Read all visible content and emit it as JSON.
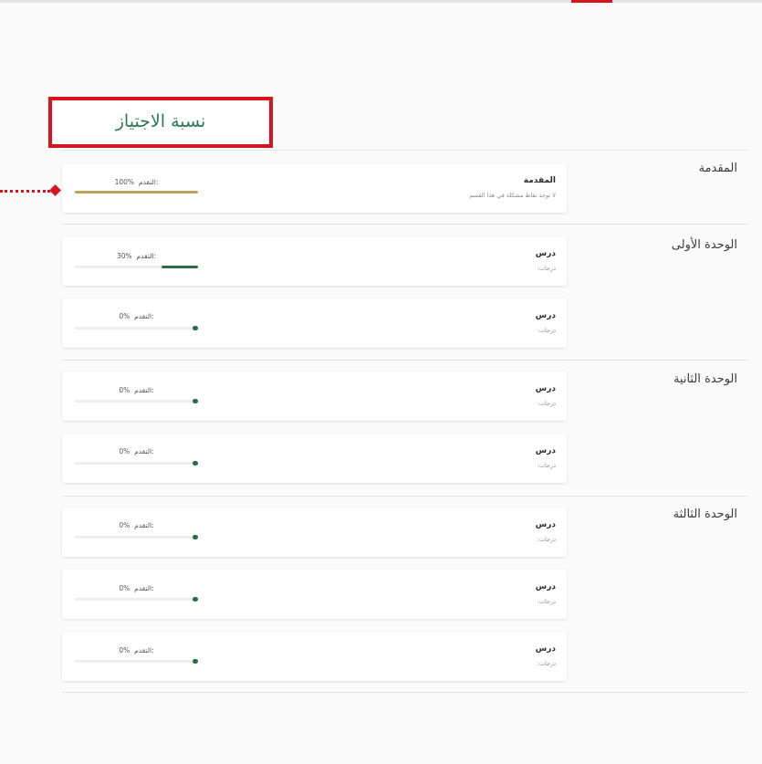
{
  "callout": {
    "text": "نسبة الاجتياز"
  },
  "progress_prefix": "التقدم:",
  "colors": {
    "accent_red": "#d5141d",
    "done_gold": "#c1a05b",
    "progress_green": "#2e6b45",
    "callout_text": "#2c7c50"
  },
  "sections": [
    {
      "title": "المقدمة",
      "cards": [
        {
          "title": "المقدمة",
          "subtitle": "لا توجد نقاط مشكلة في هذا القسم",
          "percent": "100%",
          "progress": 1.0
        }
      ]
    },
    {
      "title": "الوحدة الأولى",
      "cards": [
        {
          "title": "درس",
          "subtitle": "درجات:",
          "percent": "30%",
          "progress": 0.3
        },
        {
          "title": "درس",
          "subtitle": "درجات:",
          "percent": "0%",
          "progress": 0
        }
      ]
    },
    {
      "title": "الوحدة الثانية",
      "cards": [
        {
          "title": "درس",
          "subtitle": "درجات:",
          "percent": "0%",
          "progress": 0
        },
        {
          "title": "درس",
          "subtitle": "درجات:",
          "percent": "0%",
          "progress": 0
        }
      ]
    },
    {
      "title": "الوحدة الثالثة",
      "cards": [
        {
          "title": "درس",
          "subtitle": "درجات:",
          "percent": "0%",
          "progress": 0
        },
        {
          "title": "درس",
          "subtitle": "درجات:",
          "percent": "0%",
          "progress": 0
        },
        {
          "title": "درس",
          "subtitle": "درجات:",
          "percent": "0%",
          "progress": 0
        }
      ]
    }
  ]
}
